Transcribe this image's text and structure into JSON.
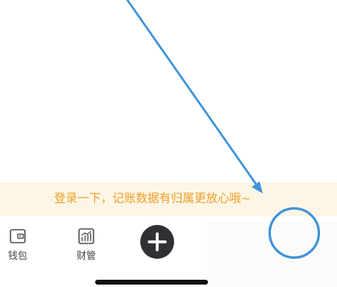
{
  "banner": {
    "login_prompt": "登录一下，记账数据有归属更放心哦~"
  },
  "bottom_nav": {
    "items": [
      {
        "label": "钱包",
        "icon": "wallet-icon"
      },
      {
        "label": "财管",
        "icon": "finance-chart-icon"
      }
    ],
    "add_button": {
      "icon": "plus-icon"
    }
  },
  "annotation": {
    "arrow_color": "#3e92d8",
    "circle_color": "#3e92d8"
  },
  "colors": {
    "banner_background": "#fdf6e6",
    "banner_text": "#eda02a",
    "add_button": "#2f3033"
  }
}
